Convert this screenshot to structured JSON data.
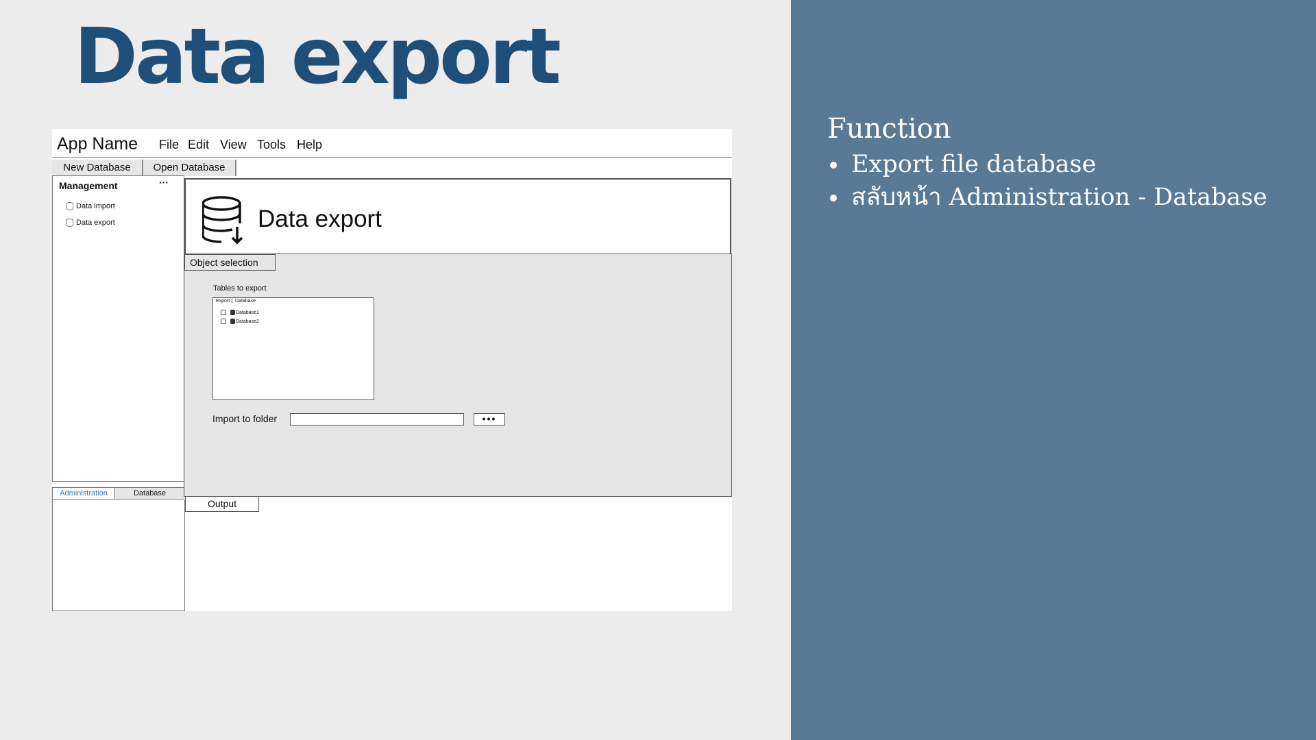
{
  "slide": {
    "title": "Data export"
  },
  "mock": {
    "app_name": "App Name",
    "menu": [
      "File",
      "Edit",
      "View",
      "Tools",
      "Help"
    ],
    "toolbar": [
      "New Database",
      "Open Database"
    ],
    "sidebar": {
      "title": "Management",
      "more": "···",
      "items": [
        {
          "label": "Data import",
          "icon": "database-icon"
        },
        {
          "label": "Data export",
          "icon": "database-icon"
        }
      ]
    },
    "left_tabs": [
      {
        "label": "Administration",
        "active": true
      },
      {
        "label": "Database",
        "active": false
      }
    ],
    "content": {
      "heading": "Data export",
      "icon": "database-download-icon",
      "tab": "Object selection",
      "tables_label": "Tables to export",
      "columns": [
        "Export",
        "Database"
      ],
      "rows": [
        {
          "checked": false,
          "name": "Database1"
        },
        {
          "checked": false,
          "name": "Database2"
        }
      ],
      "folder_label": "Import to folder",
      "folder_value": "",
      "browse": "•••"
    },
    "output_tab": "Output"
  },
  "panel": {
    "heading": "Function",
    "bullets": [
      "Export file database",
      "สลับหน้า Administration - Database"
    ]
  },
  "colors": {
    "title": "#1f4e79",
    "panel": "#587a96",
    "link": "#3a78c2"
  }
}
